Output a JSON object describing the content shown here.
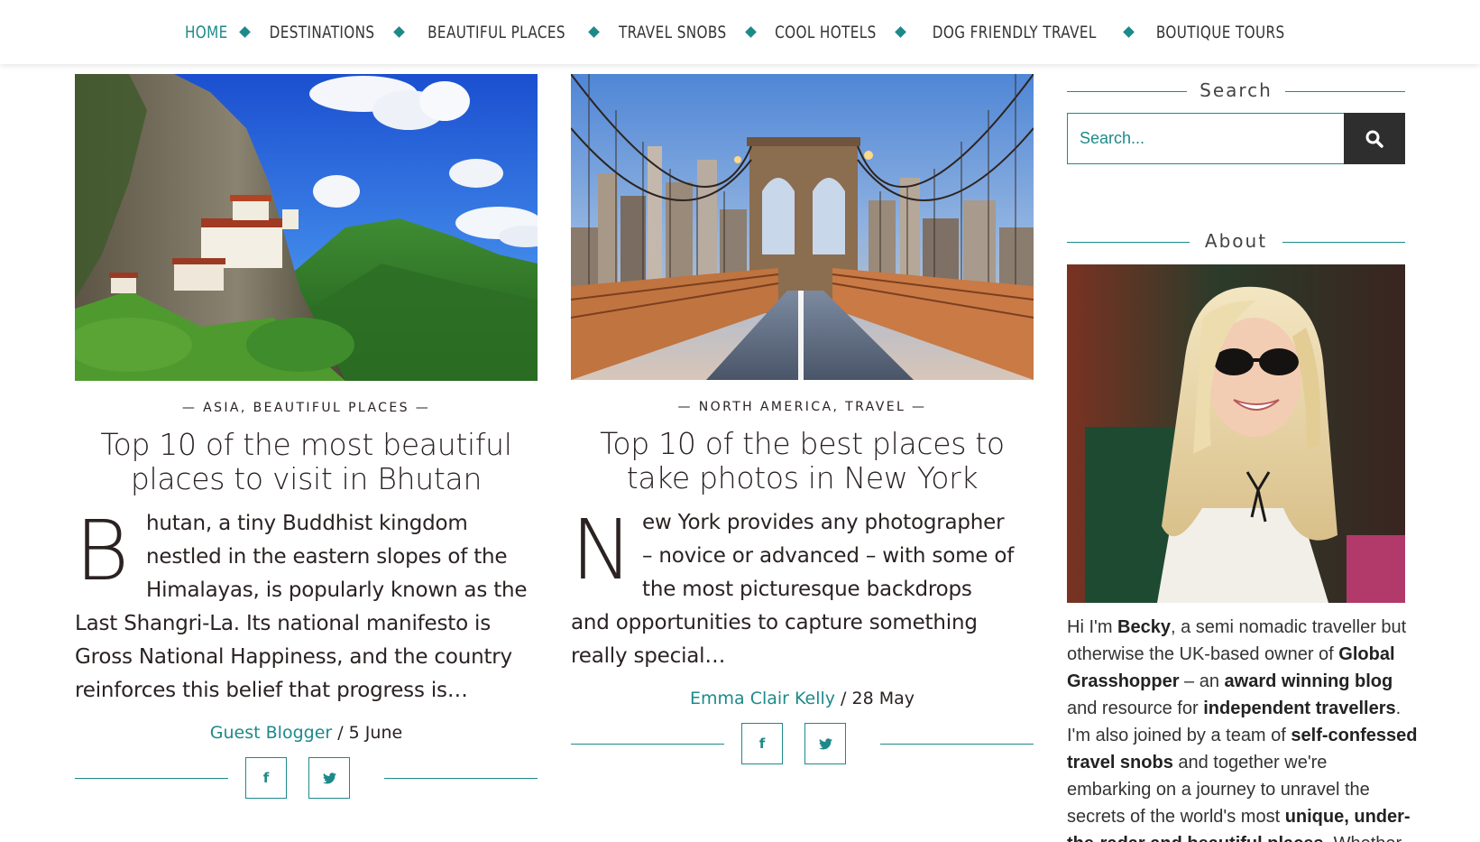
{
  "nav": {
    "items": [
      {
        "label": "HOME",
        "active": true
      },
      {
        "label": "DESTINATIONS"
      },
      {
        "label": "BEAUTIFUL PLACES"
      },
      {
        "label": "TRAVEL SNOBS"
      },
      {
        "label": "COOL HOTELS"
      },
      {
        "label": "DOG FRIENDLY TRAVEL"
      },
      {
        "label": "BOUTIQUE TOURS"
      }
    ]
  },
  "posts": [
    {
      "categories": [
        "ASIA",
        "BEAUTIFUL PLACES"
      ],
      "cat_sep": ", ",
      "dash": "—",
      "title_lines": [
        "Top 10 of the most beautiful",
        "places to visit in Bhutan"
      ],
      "dropcap": "B",
      "excerpt_lines": [
        "hutan, a tiny Buddhist kingdom",
        "nestled in the eastern slopes of the",
        "Himalayas, is popularly known as the",
        "Last Shangri-La. Its national manifesto is",
        "Gross National Happiness, and the country",
        "reinforces this belief that progress is…"
      ],
      "author": "Guest Blogger",
      "date": " / 5 June",
      "share_facebook": "f",
      "share_twitter": "t",
      "image_icon": "bhutan-tigers-nest-photo"
    },
    {
      "categories": [
        "NORTH AMERICA",
        "TRAVEL"
      ],
      "cat_sep": ", ",
      "dash": "—",
      "title_lines": [
        "Top 10 of the best places to",
        "take photos in New York"
      ],
      "dropcap": "N",
      "excerpt_lines": [
        "ew York provides any photographer",
        "– novice or advanced – with some of",
        "the most picturesque backdrops",
        "and opportunities to capture something",
        "really special…"
      ],
      "author": "Emma Clair Kelly",
      "date": " / 28 May",
      "share_facebook": "f",
      "share_twitter": "t",
      "image_icon": "brooklyn-bridge-photo"
    }
  ],
  "sidebar": {
    "search_title": "Search",
    "search_placeholder": "Search...",
    "search_icon": "search-icon",
    "about_title": "About",
    "about_lines": [
      [
        {
          "t": "Hi I'm "
        },
        {
          "t": "Becky",
          "b": true
        },
        {
          "t": ", a semi nomadic traveller but"
        }
      ],
      [
        {
          "t": "otherwise the UK-based owner of "
        },
        {
          "t": "Global",
          "b": true
        }
      ],
      [
        {
          "t": "Grasshopper",
          "b": true
        },
        {
          "t": " – an "
        },
        {
          "t": "award winning blog",
          "b": true
        }
      ],
      [
        {
          "t": "and resource for "
        },
        {
          "t": "independent travellers",
          "b": true
        },
        {
          "t": "."
        }
      ],
      [
        {
          "t": "I'm also joined by a team of "
        },
        {
          "t": "self-confessed",
          "b": true
        }
      ],
      [
        {
          "t": "travel snobs",
          "b": true
        },
        {
          "t": " and together we're"
        }
      ],
      [
        {
          "t": "embarking on a journey to unravel the"
        }
      ],
      [
        {
          "t": "secrets of the world's most "
        },
        {
          "t": "unique, under-",
          "b": true
        }
      ],
      [
        {
          "t": "the-radar and beautiful places",
          "b": true
        },
        {
          "t": ". Whether"
        }
      ]
    ]
  },
  "colors": {
    "accent": "#1d8a8a",
    "text": "#2b2222",
    "search_button": "#2e2e2e"
  }
}
